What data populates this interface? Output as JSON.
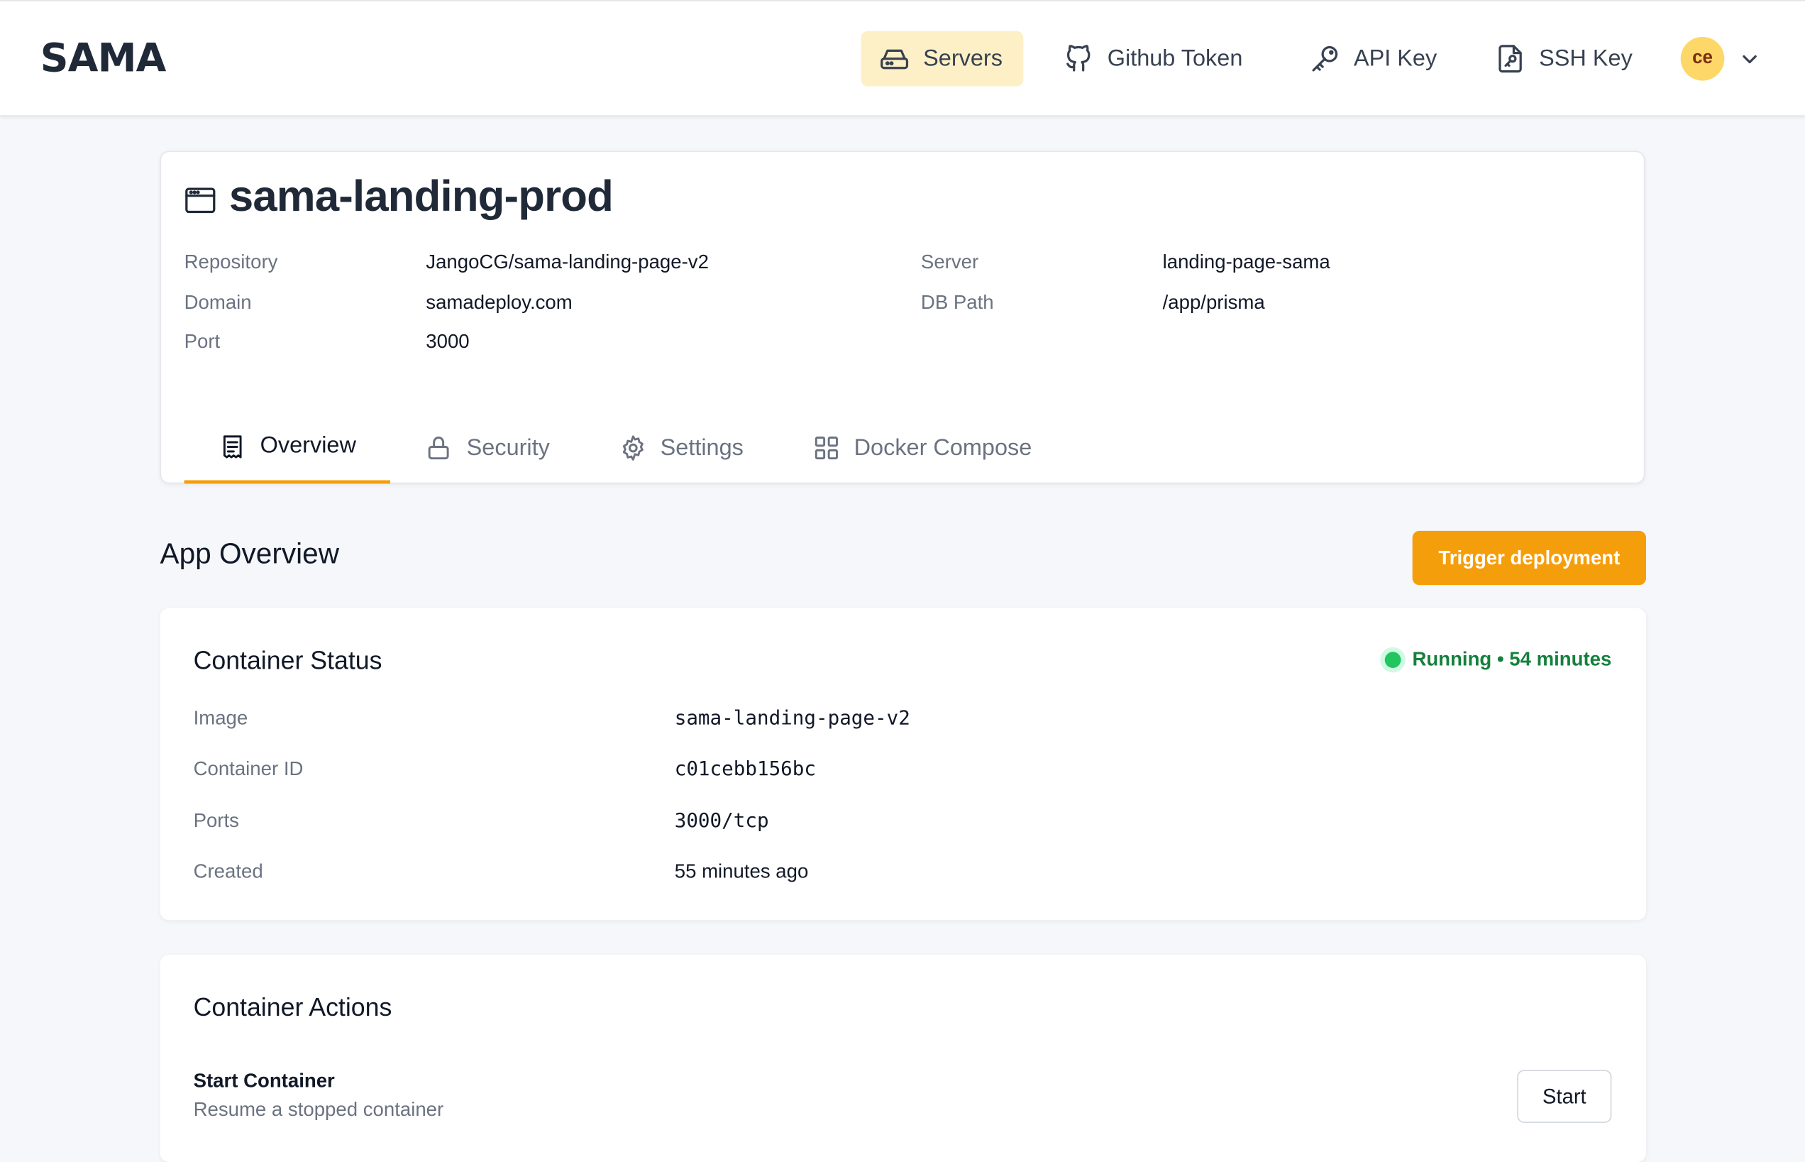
{
  "brand": {
    "logo_text": "SAMA"
  },
  "nav": {
    "servers": "Servers",
    "github_token": "Github Token",
    "api_key": "API Key",
    "ssh_key": "SSH Key",
    "avatar_initials": "ce"
  },
  "app": {
    "title": "sama-landing-prod",
    "meta": {
      "repository_label": "Repository",
      "repository_value": "JangoCG/sama-landing-page-v2",
      "domain_label": "Domain",
      "domain_value": "samadeploy.com",
      "port_label": "Port",
      "port_value": "3000",
      "server_label": "Server",
      "server_value": "landing-page-sama",
      "dbpath_label": "DB Path",
      "dbpath_value": "/app/prisma"
    },
    "tabs": [
      {
        "label": "Overview",
        "icon": "receipt-icon"
      },
      {
        "label": "Security",
        "icon": "lock-icon"
      },
      {
        "label": "Settings",
        "icon": "gear-icon"
      },
      {
        "label": "Docker Compose",
        "icon": "grid-icon"
      }
    ]
  },
  "overview": {
    "title": "App Overview",
    "trigger_label": "Trigger deployment"
  },
  "container_status": {
    "title": "Container Status",
    "status_text": "Running • 54 minutes",
    "rows": [
      {
        "label": "Image",
        "value": "sama-landing-page-v2"
      },
      {
        "label": "Container ID",
        "value": "c01cebb156bc"
      },
      {
        "label": "Ports",
        "value": "3000/tcp"
      },
      {
        "label": "Created",
        "value": "55 minutes ago"
      }
    ]
  },
  "container_actions": {
    "title": "Container Actions",
    "start_title": "Start Container",
    "start_desc": "Resume a stopped container",
    "start_button": "Start"
  },
  "colors": {
    "accent": "#f59e0b",
    "nav_active_bg": "#fdf0c6",
    "status_green": "#22c55e"
  }
}
